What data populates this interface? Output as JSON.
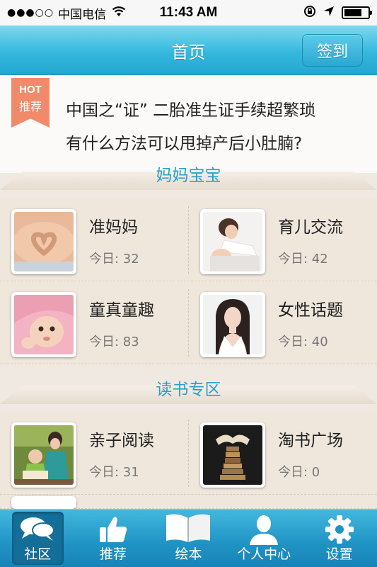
{
  "status_bar": {
    "signal": "●●●○○",
    "carrier": "中国电信",
    "time": "11:43 AM",
    "battery_level": 0.75
  },
  "navbar": {
    "title": "首页",
    "signin_label": "签到"
  },
  "hot": {
    "badge_top": "HOT",
    "badge_bottom": "推荐",
    "headlines": [
      "中国之“证” 二胎准生证手续超繁琐",
      "有什么方法可以甩掉产后小肚腩?"
    ]
  },
  "sections": [
    {
      "title": "妈妈宝宝",
      "forums": [
        {
          "name": "准妈妈",
          "count": "今日: 32"
        },
        {
          "name": "育儿交流",
          "count": "今日: 42"
        },
        {
          "name": "童真童趣",
          "count": "今日: 83"
        },
        {
          "name": "女性话题",
          "count": "今日: 40"
        }
      ]
    },
    {
      "title": "读书专区",
      "forums": [
        {
          "name": "亲子阅读",
          "count": "今日: 31"
        },
        {
          "name": "淘书广场",
          "count": "今日: 0"
        }
      ]
    }
  ],
  "tabs": [
    {
      "label": "社区",
      "icon": "chat-bubbles-icon",
      "active": true
    },
    {
      "label": "推荐",
      "icon": "thumbs-up-icon",
      "active": false
    },
    {
      "label": "绘本",
      "icon": "open-book-icon",
      "active": false
    },
    {
      "label": "个人中心",
      "icon": "person-icon",
      "active": false
    },
    {
      "label": "设置",
      "icon": "gear-icon",
      "active": false
    }
  ],
  "colors": {
    "accent": "#2aa7d2",
    "section_title": "#2c9fc9",
    "hot_ribbon": "#f08a6a"
  }
}
